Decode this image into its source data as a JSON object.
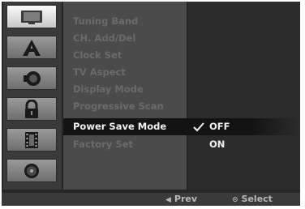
{
  "icons": [
    {
      "name": "monitor-icon",
      "selected": true
    },
    {
      "name": "letter-a-icon",
      "selected": false
    },
    {
      "name": "speaker-icon",
      "selected": false
    },
    {
      "name": "lock-icon",
      "selected": false
    },
    {
      "name": "film-icon",
      "selected": false
    },
    {
      "name": "disc-icon",
      "selected": false
    }
  ],
  "menu": {
    "items": [
      {
        "label": "Tuning Band"
      },
      {
        "label": "CH. Add/Del"
      },
      {
        "label": "Clock Set"
      },
      {
        "label": "TV Aspect"
      },
      {
        "label": "Display Mode"
      },
      {
        "label": "Progressive Scan"
      },
      {
        "label": "Power Save Mode"
      },
      {
        "label": "Factory Set"
      }
    ],
    "active_index": 6
  },
  "options": {
    "items": [
      {
        "label": "OFF",
        "checked": true
      },
      {
        "label": "ON",
        "checked": false
      }
    ]
  },
  "status": {
    "prev_glyph": "◀",
    "prev_label": "Prev",
    "select_glyph": "⊙",
    "select_label": "Select"
  },
  "colors": {
    "highlight_bg": "#131313",
    "active_text": "#f2f2f2",
    "dim_text": "#6a6a6a"
  }
}
